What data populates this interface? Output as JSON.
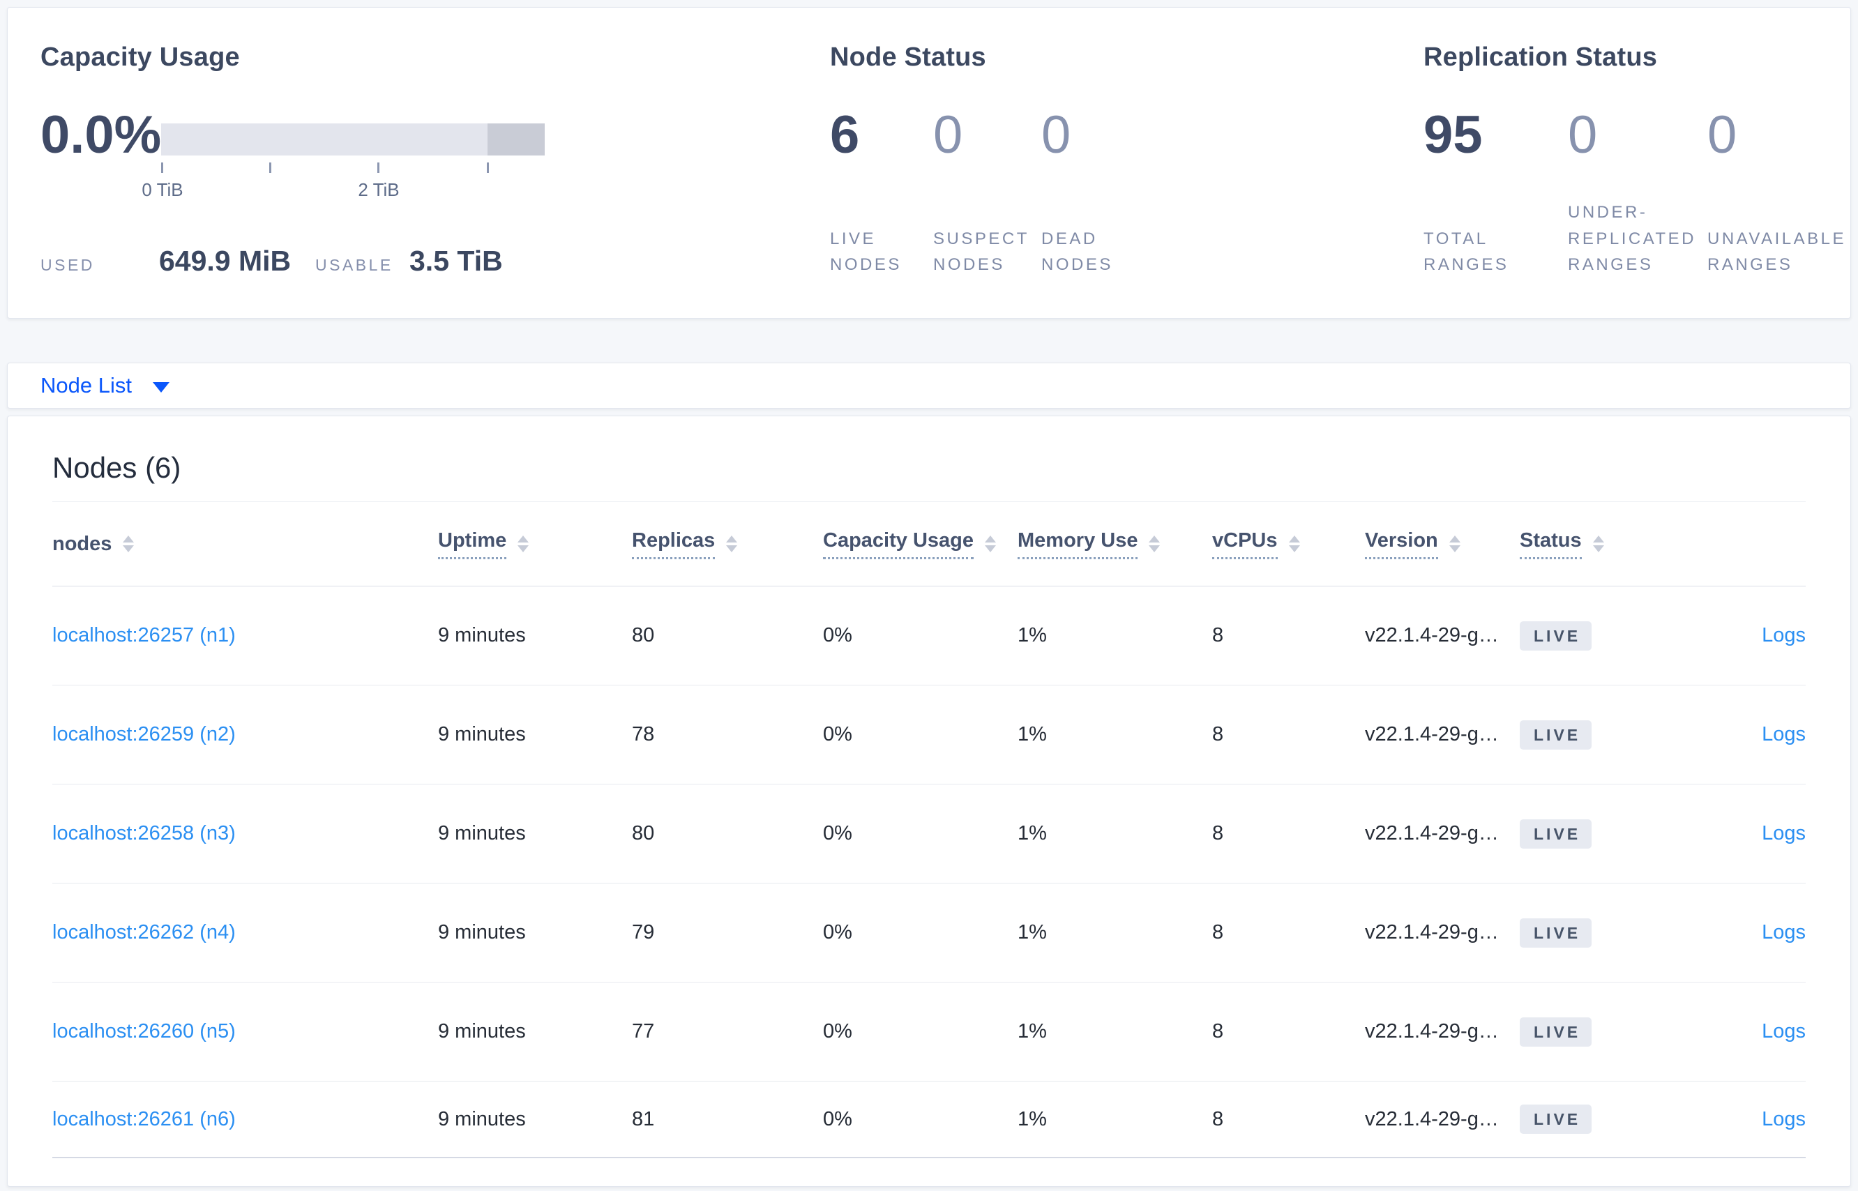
{
  "colors": {
    "page_bg": "#f5f7fa",
    "accent_link_blue": "#0b57fb",
    "table_link_blue": "#2b8ff2",
    "badge_bg": "#e7eaf1",
    "badge_text": "#475469",
    "gauge_light": "#e3e5ed",
    "gauge_dark": "#c9ccd6"
  },
  "summary": {
    "capacity": {
      "title": "Capacity Usage",
      "percent": "0.0%",
      "tick_label_0": "0 TiB",
      "tick_label_2": "2 TiB",
      "used_label": "USED",
      "used_value": "649.9 MiB",
      "usable_label": "USABLE",
      "usable_value": "3.5 TiB"
    },
    "node_status": {
      "title": "Node Status",
      "stats": [
        {
          "value": "6",
          "label": "LIVE\nNODES"
        },
        {
          "value": "0",
          "label": "SUSPECT\nNODES"
        },
        {
          "value": "0",
          "label": "DEAD\nNODES"
        }
      ]
    },
    "replication": {
      "title": "Replication Status",
      "stats": [
        {
          "value": "95",
          "label": "TOTAL\nRANGES"
        },
        {
          "value": "0",
          "label": "UNDER-\nREPLICATED\nRANGES"
        },
        {
          "value": "0",
          "label": "UNAVAILABLE\nRANGES"
        }
      ]
    }
  },
  "view_selector": {
    "label": "Node List"
  },
  "nodes_section": {
    "title": "Nodes (6)",
    "columns": [
      {
        "label": "nodes"
      },
      {
        "label": "Uptime"
      },
      {
        "label": "Replicas"
      },
      {
        "label": "Capacity Usage"
      },
      {
        "label": "Memory Use"
      },
      {
        "label": "vCPUs"
      },
      {
        "label": "Version"
      },
      {
        "label": "Status"
      }
    ],
    "rows": [
      {
        "node": "localhost:26257 (n1)",
        "uptime": "9 minutes",
        "replicas": "80",
        "capacity": "0%",
        "memory": "1%",
        "vcpus": "8",
        "version": "v22.1.4-29-g…",
        "status": "LIVE",
        "logs": "Logs"
      },
      {
        "node": "localhost:26259 (n2)",
        "uptime": "9 minutes",
        "replicas": "78",
        "capacity": "0%",
        "memory": "1%",
        "vcpus": "8",
        "version": "v22.1.4-29-g…",
        "status": "LIVE",
        "logs": "Logs"
      },
      {
        "node": "localhost:26258 (n3)",
        "uptime": "9 minutes",
        "replicas": "80",
        "capacity": "0%",
        "memory": "1%",
        "vcpus": "8",
        "version": "v22.1.4-29-g…",
        "status": "LIVE",
        "logs": "Logs"
      },
      {
        "node": "localhost:26262 (n4)",
        "uptime": "9 minutes",
        "replicas": "79",
        "capacity": "0%",
        "memory": "1%",
        "vcpus": "8",
        "version": "v22.1.4-29-g…",
        "status": "LIVE",
        "logs": "Logs"
      },
      {
        "node": "localhost:26260 (n5)",
        "uptime": "9 minutes",
        "replicas": "77",
        "capacity": "0%",
        "memory": "1%",
        "vcpus": "8",
        "version": "v22.1.4-29-g…",
        "status": "LIVE",
        "logs": "Logs"
      },
      {
        "node": "localhost:26261 (n6)",
        "uptime": "9 minutes",
        "replicas": "81",
        "capacity": "0%",
        "memory": "1%",
        "vcpus": "8",
        "version": "v22.1.4-29-g…",
        "status": "LIVE",
        "logs": "Logs"
      }
    ]
  }
}
